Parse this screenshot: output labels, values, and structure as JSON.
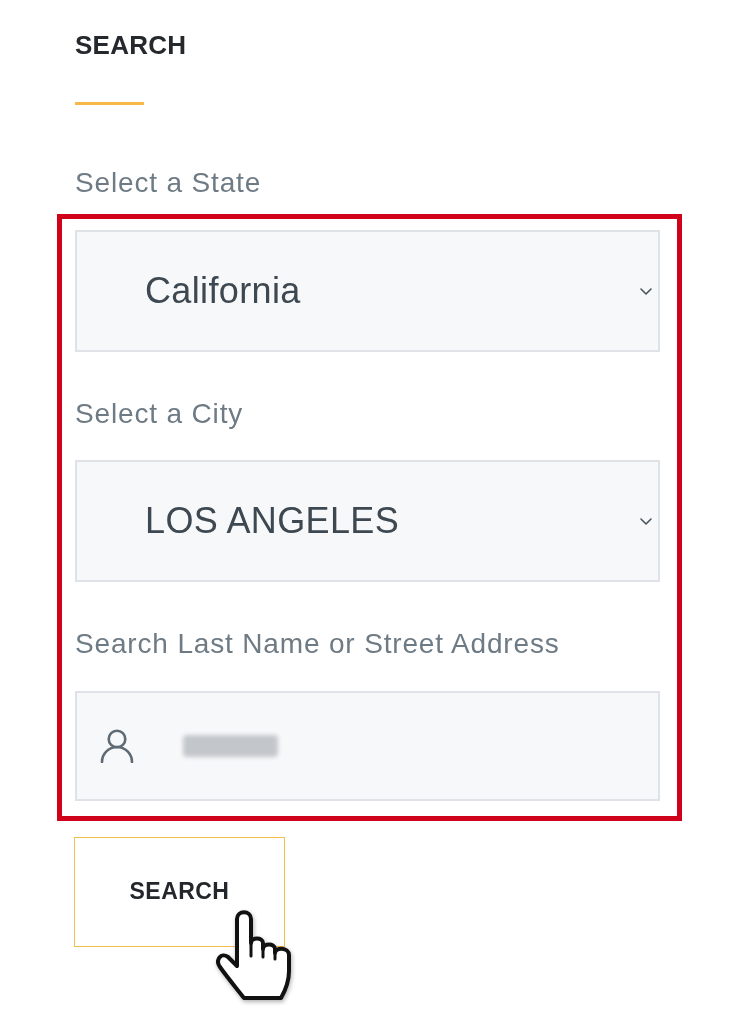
{
  "section": {
    "title": "SEARCH"
  },
  "fields": [
    {
      "kind": "select",
      "label": "Select a State",
      "value": "California"
    },
    {
      "kind": "select",
      "label": "Select a City",
      "value": "LOS ANGELES"
    },
    {
      "kind": "text",
      "label": "Search Last Name or Street Address",
      "value_blurred": true
    }
  ],
  "fields_highlighted": true,
  "search_button": {
    "label": "SEARCH"
  },
  "cursor": {
    "kind": "hand"
  }
}
